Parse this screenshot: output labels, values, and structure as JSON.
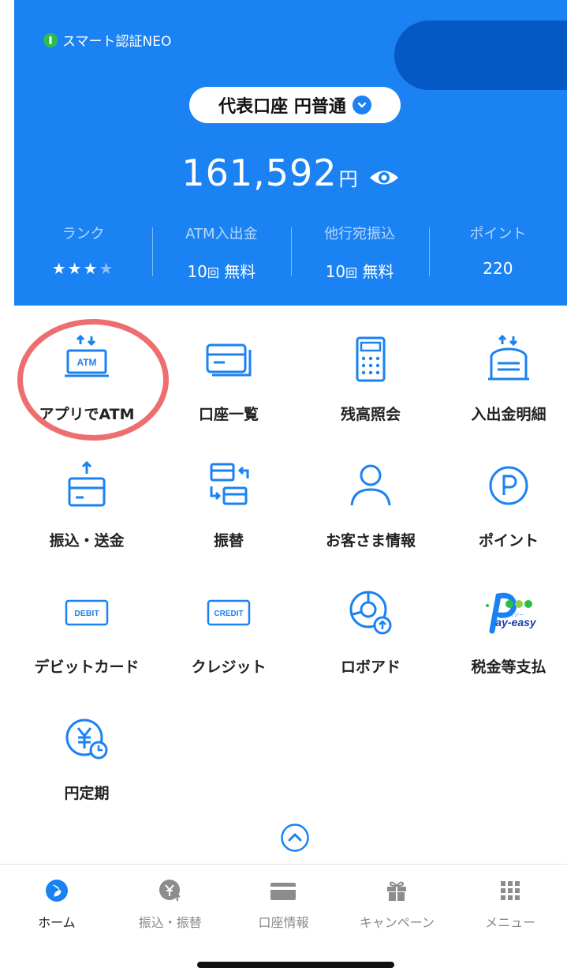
{
  "header": {
    "auth_label": "スマート認証NEO",
    "account_selector": "代表口座 円普通",
    "balance_amount": "161,592",
    "balance_unit": "円"
  },
  "stats": [
    {
      "label": "ランク",
      "value": "★★★★"
    },
    {
      "label": "ATM入出金",
      "value_count": "10",
      "value_unit": "回",
      "value_note": "無料"
    },
    {
      "label": "他行宛振込",
      "value_count": "10",
      "value_unit": "回",
      "value_note": "無料"
    },
    {
      "label": "ポイント",
      "value": "220"
    }
  ],
  "rank": {
    "filled": 3,
    "total": 4
  },
  "menu": [
    {
      "label": "アプリでATM",
      "icon": "atm-icon"
    },
    {
      "label": "口座一覧",
      "icon": "card-list-icon"
    },
    {
      "label": "残高照会",
      "icon": "calculator-icon"
    },
    {
      "label": "入出金明細",
      "icon": "statement-icon"
    },
    {
      "label": "振込・送金",
      "icon": "transfer-send-icon"
    },
    {
      "label": "振替",
      "icon": "account-transfer-icon"
    },
    {
      "label": "お客さま情報",
      "icon": "person-icon"
    },
    {
      "label": "ポイント",
      "icon": "point-icon"
    },
    {
      "label": "デビットカード",
      "icon": "debit-card-icon",
      "badge": "DEBIT"
    },
    {
      "label": "クレジット",
      "icon": "credit-card-icon",
      "badge": "CREDIT"
    },
    {
      "label": "ロボアド",
      "icon": "robo-advisor-icon"
    },
    {
      "label": "税金等支払",
      "icon": "pay-easy-logo",
      "logo_text": "ay-easy",
      "logo_sub": "ペイジー"
    },
    {
      "label": "円定期",
      "icon": "yen-time-deposit-icon"
    }
  ],
  "atm_badge": "ATM",
  "tabs": [
    {
      "label": "ホーム",
      "icon": "home-icon",
      "active": true
    },
    {
      "label": "振込・振替",
      "icon": "yen-transfer-icon",
      "active": false
    },
    {
      "label": "口座情報",
      "icon": "card-icon",
      "active": false
    },
    {
      "label": "キャンペーン",
      "icon": "gift-icon",
      "active": false
    },
    {
      "label": "メニュー",
      "icon": "grid-menu-icon",
      "active": false
    }
  ],
  "colors": {
    "brand_blue": "#1a82f2",
    "highlight_red": "#ee6e70",
    "shield_green": "#2bbf4a"
  }
}
